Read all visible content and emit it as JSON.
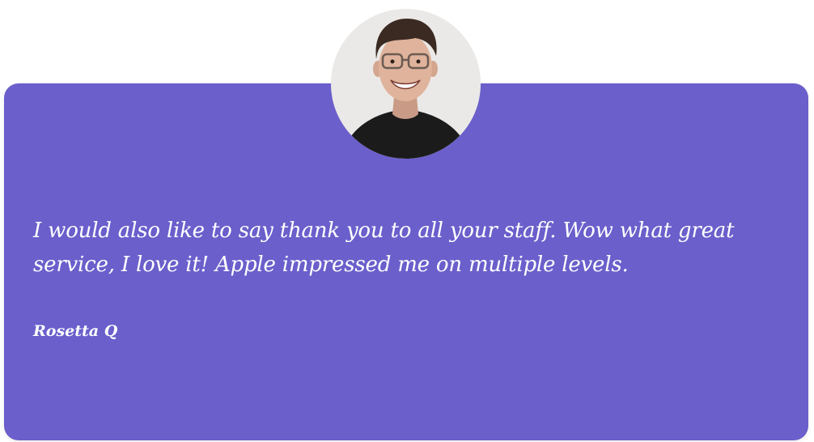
{
  "testimonial": {
    "quote": "I would also like to say thank you to all your staff. Wow what great service, I love it! Apple impressed me on multiple levels.",
    "author": "Rosetta Q"
  },
  "colors": {
    "card_background": "#6a5fcb",
    "text": "#ffffff",
    "avatar_background": "#e9e7e5"
  }
}
